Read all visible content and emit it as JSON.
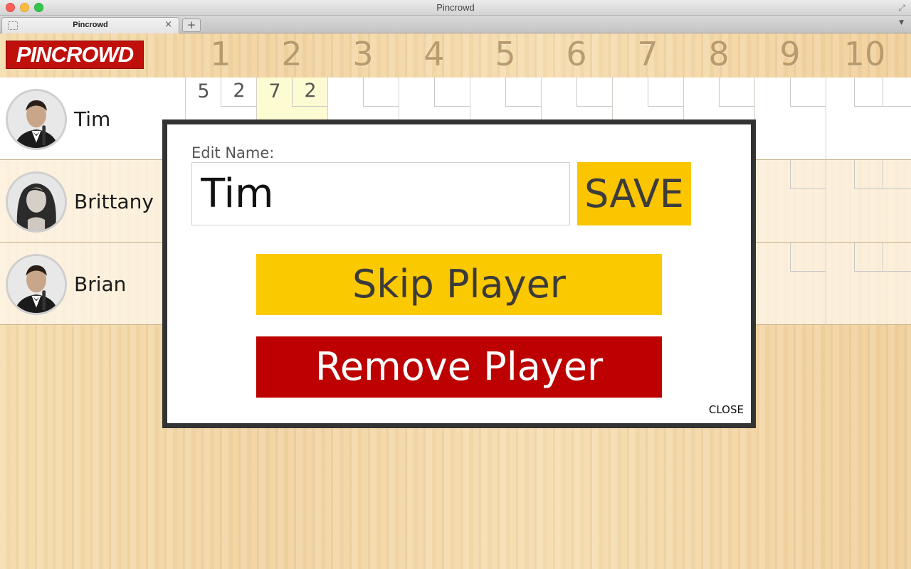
{
  "window": {
    "title": "Pincrowd",
    "tab_title": "Pincrowd",
    "tab_close": "×",
    "new_tab": "+",
    "tab_menu": "▼",
    "fullscreen": "⤢"
  },
  "header": {
    "logo": "PINCROWD",
    "frames": [
      "1",
      "2",
      "3",
      "4",
      "5",
      "6",
      "7",
      "8",
      "9",
      "10"
    ]
  },
  "players": [
    {
      "name": "Tim",
      "frames": [
        [
          "5",
          "2"
        ],
        [
          "7",
          "2"
        ]
      ],
      "current_frame": 2
    },
    {
      "name": "Brittany",
      "frames": []
    },
    {
      "name": "Brian",
      "frames": []
    }
  ],
  "modal": {
    "edit_label": "Edit Name:",
    "name_value": "Tim",
    "save_label": "SAVE",
    "skip_label": "Skip Player",
    "remove_label": "Remove Player",
    "close_label": "CLOSE"
  },
  "colors": {
    "logo_red": "#c0100c",
    "save_yellow": "#fbc500",
    "skip_yellow": "#fbc900",
    "remove_red": "#bd0000",
    "modal_border": "#333333",
    "current_frame_highlight": "#fdfbd2"
  }
}
